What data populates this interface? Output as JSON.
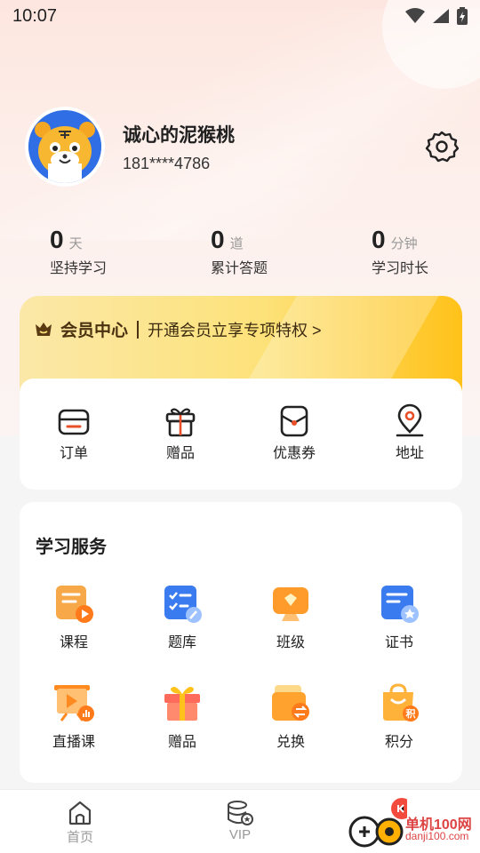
{
  "status_bar": {
    "time": "10:07"
  },
  "profile": {
    "name": "诚心的泥猴桃",
    "phone": "181****4786"
  },
  "stats": [
    {
      "value": "0",
      "unit": "天",
      "label": "坚持学习"
    },
    {
      "value": "0",
      "unit": "道",
      "label": "累计答题"
    },
    {
      "value": "0",
      "unit": "分钟",
      "label": "学习时长"
    }
  ],
  "vip": {
    "title": "会员中心",
    "desc": "开通会员立享专项特权 >"
  },
  "orders": [
    {
      "label": "订单",
      "icon": "order-icon"
    },
    {
      "label": "赠品",
      "icon": "gift-icon"
    },
    {
      "label": "优惠券",
      "icon": "coupon-icon"
    },
    {
      "label": "地址",
      "icon": "location-icon"
    }
  ],
  "services": {
    "title": "学习服务",
    "items": [
      {
        "label": "课程",
        "icon": "course-icon"
      },
      {
        "label": "题库",
        "icon": "question-bank-icon"
      },
      {
        "label": "班级",
        "icon": "class-icon"
      },
      {
        "label": "证书",
        "icon": "certificate-icon"
      },
      {
        "label": "直播课",
        "icon": "live-class-icon"
      },
      {
        "label": "赠品",
        "icon": "gift-box-icon"
      },
      {
        "label": "兑换",
        "icon": "exchange-icon"
      },
      {
        "label": "积分",
        "icon": "points-icon"
      }
    ]
  },
  "tabbar": [
    {
      "label": "首页",
      "icon": "home-icon"
    },
    {
      "label": "VIP",
      "icon": "vip-icon"
    }
  ],
  "watermark": {
    "text": "单机100网",
    "sub": "danji100.com"
  },
  "colors": {
    "accent_orange": "#ff8a1f",
    "vip_gold": "#ffc21a",
    "blue": "#3a7bf0"
  }
}
